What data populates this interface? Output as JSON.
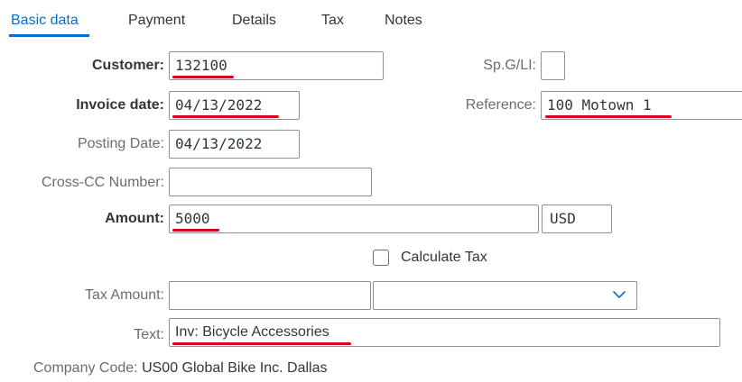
{
  "tabs": [
    {
      "label": "Basic data",
      "active": true
    },
    {
      "label": "Payment"
    },
    {
      "label": "Details"
    },
    {
      "label": "Tax"
    },
    {
      "label": "Notes"
    }
  ],
  "form": {
    "customer": {
      "label": "Customer:",
      "value": "132100"
    },
    "spgl": {
      "label": "Sp.G/LI:",
      "value": ""
    },
    "invoice_date": {
      "label": "Invoice date:",
      "value": "04/13/2022"
    },
    "reference": {
      "label": "Reference:",
      "value": "100 Motown 1"
    },
    "posting_date": {
      "label": "Posting Date:",
      "value": "04/13/2022"
    },
    "cross_cc": {
      "label": "Cross-CC Number:",
      "value": ""
    },
    "amount": {
      "label": "Amount:",
      "value": "5000",
      "currency": "USD"
    },
    "calculate_tax": {
      "label": "Calculate Tax",
      "checked": false
    },
    "tax_amount": {
      "label": "Tax Amount:",
      "value": "",
      "code_value": ""
    },
    "text": {
      "label": "Text:",
      "value": "Inv: Bicycle Accessories"
    },
    "company_code": {
      "label": "Company Code:",
      "value": "US00 Global Bike Inc. Dallas"
    }
  },
  "icons": {
    "select_chevron": "chevron-down-icon"
  },
  "colors": {
    "accent": "#0a6ed1",
    "annotation": "#d9001b",
    "border": "#89919a",
    "text": "#32363a",
    "label": "#6a6d70"
  }
}
